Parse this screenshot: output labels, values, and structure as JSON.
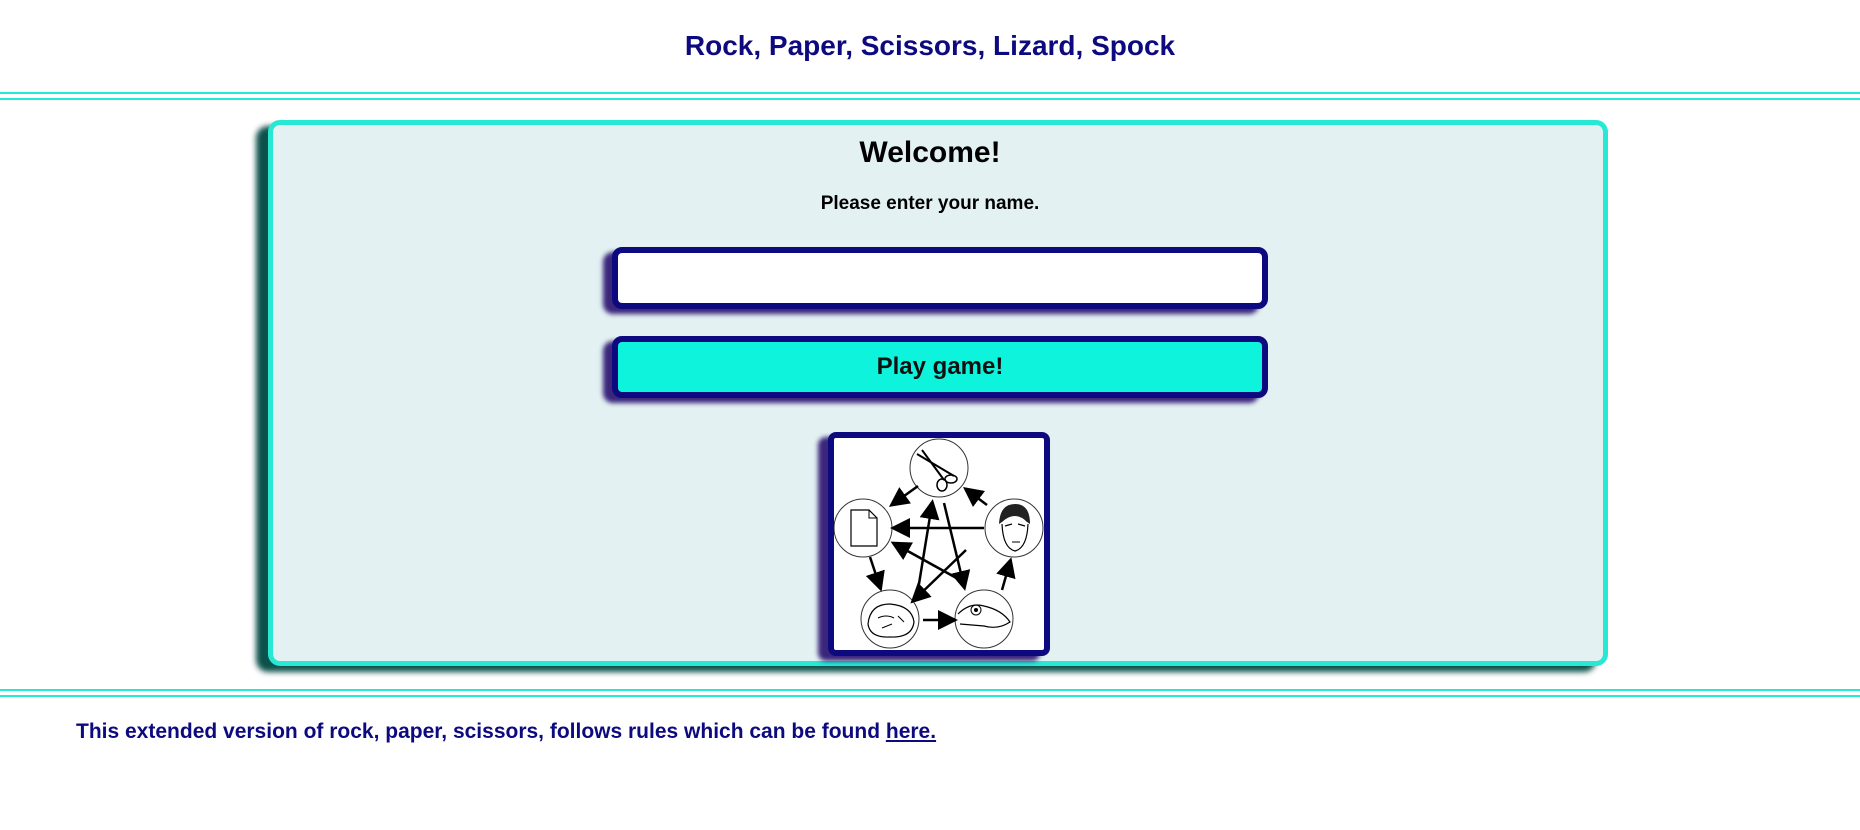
{
  "header": {
    "title": "Rock, Paper, Scissors, Lizard, Spock"
  },
  "colors": {
    "navy": "#0d0a80",
    "accent": "#27e8d2",
    "button": "#0ef4dc",
    "panel": "#e3f1f3"
  },
  "welcome": {
    "heading": "Welcome!",
    "prompt": "Please enter your name.",
    "name_input": {
      "value": "",
      "placeholder": ""
    },
    "play_button_label": "Play game!"
  },
  "diagram": {
    "icons": [
      "scissors-icon",
      "paper-icon",
      "spock-icon",
      "rock-icon",
      "lizard-icon"
    ]
  },
  "footer": {
    "text": "This extended version of rock, paper, scissors, follows rules which can be found ",
    "link_label": "here."
  }
}
